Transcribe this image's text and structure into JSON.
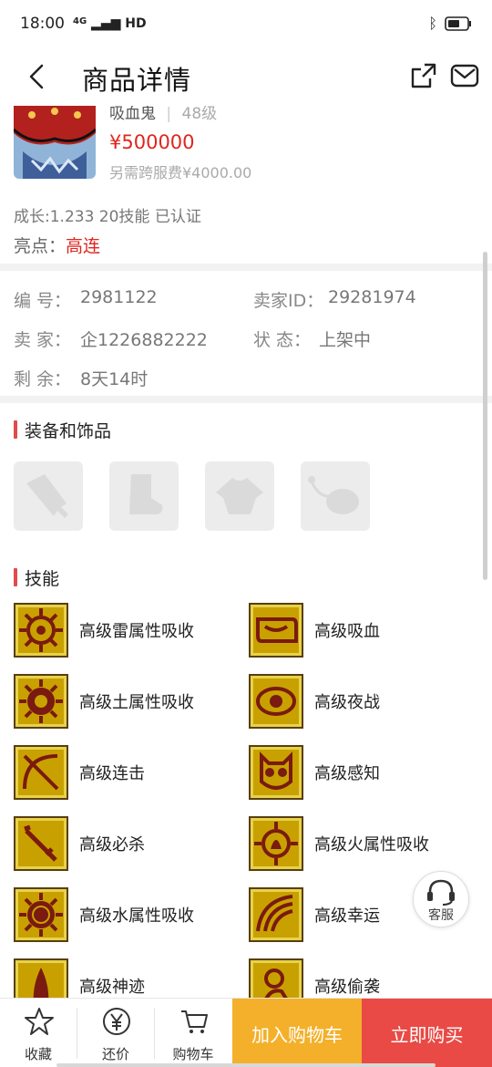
{
  "status": {
    "time": "18:00",
    "network": "4G",
    "hd": "HD"
  },
  "header": {
    "title": "商品详情"
  },
  "item": {
    "name": "吸血鬼",
    "level": "48级",
    "price": "¥500000",
    "fee": "另需跨服费¥4000.00",
    "growth": "成长:1.233 20技能 已认证",
    "highlight_label": "亮点：",
    "highlight_value": "高连"
  },
  "info": [
    {
      "label": "编  号：",
      "value": "2981122"
    },
    {
      "label": "卖家ID：",
      "value": "29281974"
    },
    {
      "label": "卖  家：",
      "value": "企1226882222"
    },
    {
      "label": "状  态：",
      "value": "上架中"
    },
    {
      "label": "剩  余：",
      "value": "8天14时"
    }
  ],
  "equipment": {
    "title": "装备和饰品",
    "slots": [
      "weapon-icon",
      "boots-icon",
      "armor-icon",
      "accessory-icon"
    ]
  },
  "skills": {
    "title": "技能",
    "items": [
      {
        "label": "高级雷属性吸收",
        "icon": "thunder-absorb-icon"
      },
      {
        "label": "高级吸血",
        "icon": "vampire-icon"
      },
      {
        "label": "高级土属性吸收",
        "icon": "earth-absorb-icon"
      },
      {
        "label": "高级夜战",
        "icon": "night-fight-icon"
      },
      {
        "label": "高级连击",
        "icon": "combo-icon"
      },
      {
        "label": "高级感知",
        "icon": "perception-icon"
      },
      {
        "label": "高级必杀",
        "icon": "crit-icon"
      },
      {
        "label": "高级火属性吸收",
        "icon": "fire-absorb-icon"
      },
      {
        "label": "高级水属性吸收",
        "icon": "water-absorb-icon"
      },
      {
        "label": "高级幸运",
        "icon": "luck-icon"
      },
      {
        "label": "高级神迹",
        "icon": "miracle-icon"
      },
      {
        "label": "高级偷袭",
        "icon": "sneak-attack-icon"
      }
    ]
  },
  "customer_service": {
    "label": "客服"
  },
  "bottom_bar": {
    "favorite": "收藏",
    "bargain": "还价",
    "cart": "购物车",
    "add_to_cart": "加入购物车",
    "buy_now": "立即购买"
  },
  "colors": {
    "price": "#e0251e",
    "add_cart_bg": "#f4b02a",
    "buy_now_bg": "#e94a45",
    "skill_icon_bg": "#c8a100"
  }
}
